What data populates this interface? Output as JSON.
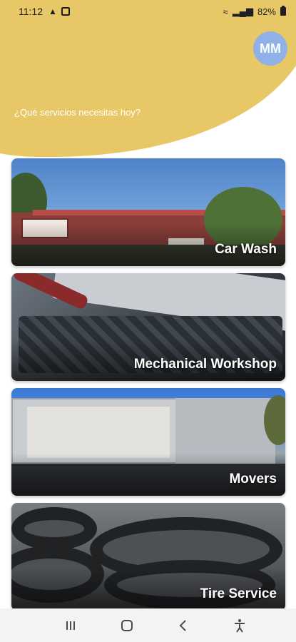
{
  "status_bar": {
    "time": "11:12",
    "battery": "82%"
  },
  "header": {
    "avatar_initials": "MM",
    "greeting": "¿Qué servicios necesitas hoy?",
    "accent_color": "#e7c766",
    "avatar_color": "#8fb1e6"
  },
  "services": [
    {
      "label": "Car Wash",
      "image": "car-wash-photo"
    },
    {
      "label": "Mechanical Workshop",
      "image": "mechanical-workshop-photo"
    },
    {
      "label": "Movers",
      "image": "movers-truck-photo"
    },
    {
      "label": "Tire Service",
      "image": "tire-service-photo"
    }
  ],
  "nav_bar": {
    "recents_icon": "recents-icon",
    "home_icon": "home-icon",
    "back_icon": "back-icon",
    "accessibility_icon": "accessibility-icon"
  }
}
